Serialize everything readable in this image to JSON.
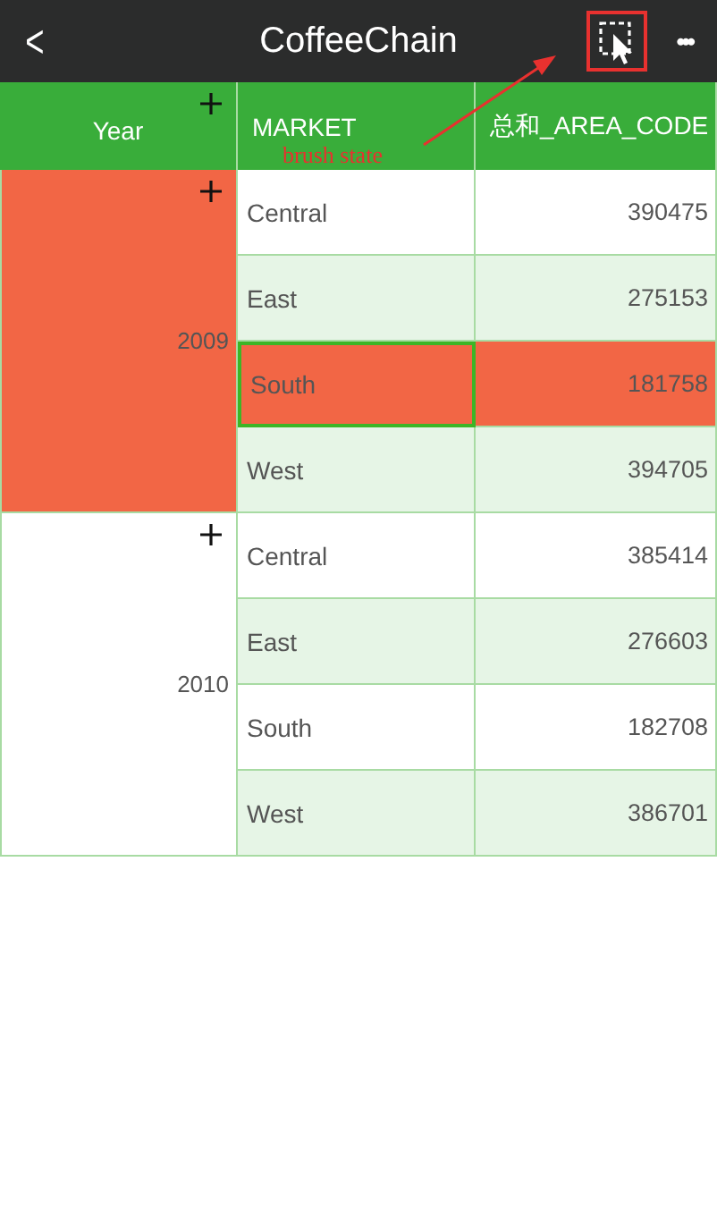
{
  "nav_bar": {
    "back": "<",
    "title": "CoffeeChain",
    "more": "•••"
  },
  "annotation": {
    "text": "brush state"
  },
  "table": {
    "columns": [
      "Year",
      "MARKET",
      "总和_AREA_CODE"
    ],
    "groups": [
      {
        "year": "2009",
        "selected": true,
        "rows": [
          {
            "market": "Central",
            "value": "390475",
            "selected": false
          },
          {
            "market": "East",
            "value": "275153",
            "selected": false
          },
          {
            "market": "South",
            "value": "181758",
            "selected": true
          },
          {
            "market": "West",
            "value": "394705",
            "selected": false
          }
        ]
      },
      {
        "year": "2010",
        "selected": false,
        "rows": [
          {
            "market": "Central",
            "value": "385414",
            "selected": false
          },
          {
            "market": "East",
            "value": "276603",
            "selected": false
          },
          {
            "market": "South",
            "value": "182708",
            "selected": false
          },
          {
            "market": "West",
            "value": "386701",
            "selected": false
          }
        ]
      }
    ]
  }
}
